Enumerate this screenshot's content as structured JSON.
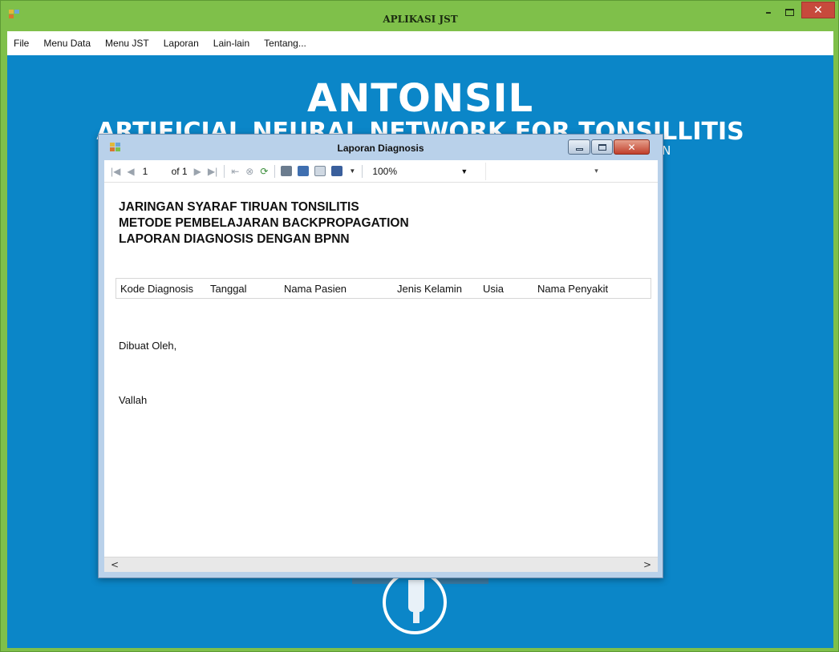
{
  "main_window": {
    "title": "APLIKASI JST",
    "min_glyph": "–",
    "close_glyph": "✕"
  },
  "menubar": {
    "items": [
      "File",
      "Menu Data",
      "Menu JST",
      "Laporan",
      "Lain-lain",
      "Tentang..."
    ]
  },
  "background": {
    "title": "ANTONSIL",
    "subtitle": "ARTIFICIAL NEURAL NETWORK FOR TONSILLITIS",
    "subtitle2": "JARINGAN SYARAF TIRUAN TONSILITIS METODE PEMBELAJARAN BACKPROPAGATION"
  },
  "report_window": {
    "title": "Laporan Diagnosis",
    "close_glyph": "✕",
    "toolbar": {
      "page_number": "1",
      "page_of": "of 1",
      "zoom": "100%"
    },
    "heading_lines": [
      "JARINGAN SYARAF TIRUAN TONSILITIS",
      "METODE PEMBELAJARAN BACKPROPAGATION",
      "LAPORAN DIAGNOSIS DENGAN BPNN"
    ],
    "table_headers": [
      "Kode Diagnosis",
      "Tanggal",
      "Nama Pasien",
      "Jenis Kelamin",
      "Usia",
      "Nama Penyakit"
    ],
    "signed_by_label": "Dibuat Oleh,",
    "signer": "Vallah"
  },
  "colors": {
    "frame": "#7fc04a",
    "content_bg": "#0b86c8",
    "close_red": "#c74a3c"
  },
  "icons": {
    "app": "app-window-icon",
    "first": "first-page-icon",
    "prev": "previous-page-icon",
    "next": "next-page-icon",
    "last": "last-page-icon",
    "back": "back-icon",
    "stop": "stop-icon",
    "refresh": "refresh-icon",
    "print": "print-icon",
    "layout": "print-layout-icon",
    "page_setup": "page-setup-icon",
    "export": "export-icon"
  }
}
